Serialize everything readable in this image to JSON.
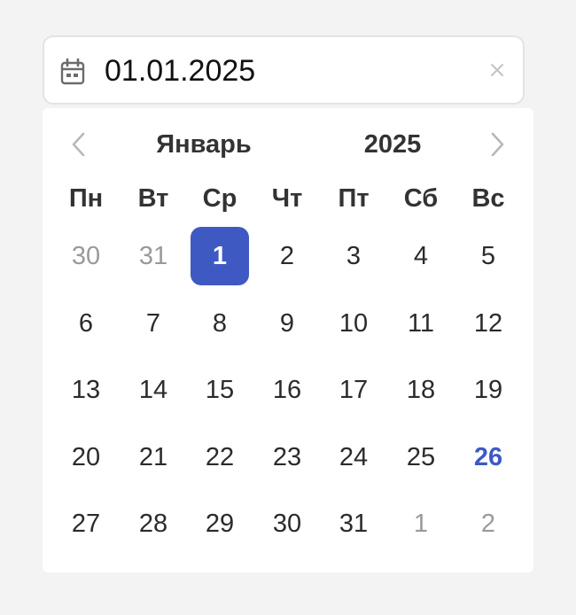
{
  "colors": {
    "accent": "#3e5ac2",
    "page_background": "#f3f3f3",
    "text": "#2b2b2b",
    "muted_text": "#9a9a9a",
    "border": "#e3e3e3"
  },
  "input": {
    "value": "01.01.2025",
    "icon": "calendar-icon",
    "clear_icon": "close-icon"
  },
  "calendar": {
    "month": "Январь",
    "year": "2025",
    "prev_icon": "chevron-left-icon",
    "next_icon": "chevron-right-icon",
    "weekdays": [
      "Пн",
      "Вт",
      "Ср",
      "Чт",
      "Пт",
      "Сб",
      "Вс"
    ],
    "weeks": [
      [
        {
          "label": "30",
          "outside": true
        },
        {
          "label": "31",
          "outside": true
        },
        {
          "label": "1",
          "selected": true
        },
        {
          "label": "2"
        },
        {
          "label": "3"
        },
        {
          "label": "4"
        },
        {
          "label": "5"
        }
      ],
      [
        {
          "label": "6"
        },
        {
          "label": "7"
        },
        {
          "label": "8"
        },
        {
          "label": "9"
        },
        {
          "label": "10"
        },
        {
          "label": "11"
        },
        {
          "label": "12"
        }
      ],
      [
        {
          "label": "13"
        },
        {
          "label": "14"
        },
        {
          "label": "15"
        },
        {
          "label": "16"
        },
        {
          "label": "17"
        },
        {
          "label": "18"
        },
        {
          "label": "19"
        }
      ],
      [
        {
          "label": "20"
        },
        {
          "label": "21"
        },
        {
          "label": "22"
        },
        {
          "label": "23"
        },
        {
          "label": "24"
        },
        {
          "label": "25"
        },
        {
          "label": "26",
          "today": true
        }
      ],
      [
        {
          "label": "27"
        },
        {
          "label": "28"
        },
        {
          "label": "29"
        },
        {
          "label": "30"
        },
        {
          "label": "31"
        },
        {
          "label": "1",
          "outside": true
        },
        {
          "label": "2",
          "outside": true
        }
      ]
    ]
  }
}
